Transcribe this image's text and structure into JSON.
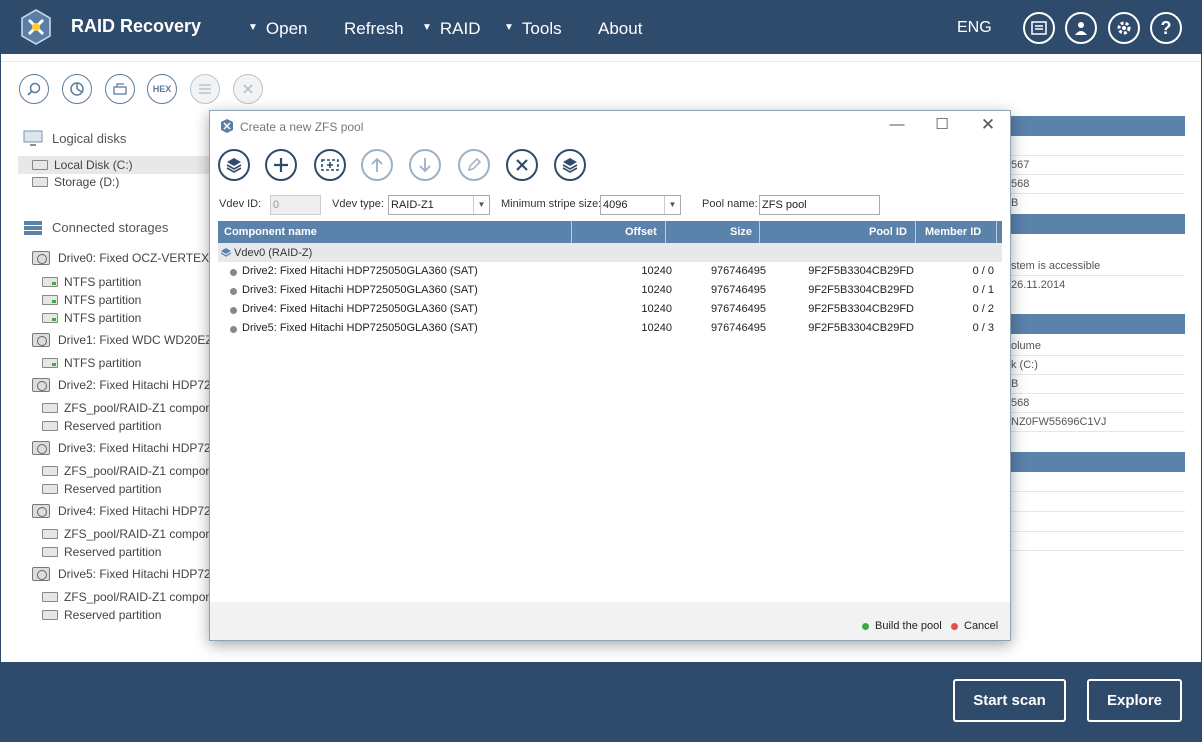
{
  "app": {
    "title": "RAID Recovery",
    "menu": [
      "Open",
      "Refresh",
      "RAID",
      "Tools",
      "About"
    ],
    "language": "ENG"
  },
  "header_icons": [
    "notes-icon",
    "user-icon",
    "gear-icon",
    "help-icon"
  ],
  "toolbar_icons": [
    "search-icon",
    "chart-icon",
    "partitions-icon",
    "hex-icon",
    "list-icon",
    "close-icon"
  ],
  "hex_label": "HEX",
  "left": {
    "logical_title": "Logical disks",
    "logical": [
      "Local Disk (C:)",
      "Storage (D:)"
    ],
    "connected_title": "Connected storages",
    "drives": [
      {
        "label": "Drive0: Fixed OCZ-VERTEX3",
        "children": [
          "NTFS partition",
          "NTFS partition",
          "NTFS partition"
        ],
        "green": true
      },
      {
        "label": "Drive1: Fixed WDC WD20EZ",
        "children": [
          "NTFS partition"
        ],
        "green": true
      },
      {
        "label": "Drive2: Fixed Hitachi HDP72",
        "children": [
          "ZFS_pool/RAID-Z1 compon",
          "Reserved partition"
        ],
        "green": false
      },
      {
        "label": "Drive3: Fixed Hitachi HDP72",
        "children": [
          "ZFS_pool/RAID-Z1 compon",
          "Reserved partition"
        ],
        "green": false
      },
      {
        "label": "Drive4: Fixed Hitachi HDP72",
        "children": [
          "ZFS_pool/RAID-Z1 compon",
          "Reserved partition"
        ],
        "green": false
      },
      {
        "label": "Drive5: Fixed Hitachi HDP72",
        "children": [
          "ZFS_pool/RAID-Z1 compon",
          "Reserved partition"
        ],
        "green": false
      }
    ]
  },
  "right_panel": {
    "rows": [
      "567",
      "568",
      "B",
      "stem is accessible",
      "26.11.2014",
      "olume",
      "k (C:)",
      "B",
      "568",
      "NZ0FW55696C1VJ"
    ]
  },
  "dialog": {
    "title": "Create a new ZFS pool",
    "vdev_id_label": "Vdev ID:",
    "vdev_id_value": "0",
    "vdev_type_label": "Vdev type:",
    "vdev_type_value": "RAID-Z1",
    "stripe_label": "Minimum stripe size:",
    "stripe_value": "4096",
    "pool_name_label": "Pool name:",
    "pool_name_value": "ZFS pool",
    "columns": {
      "name": "Component name",
      "offset": "Offset",
      "size": "Size",
      "pool_id": "Pool ID",
      "member_id": "Member ID"
    },
    "group": "Vdev0 (RAID-Z)",
    "rows": [
      {
        "name": "Drive2: Fixed Hitachi HDP725050GLA360 (SAT)",
        "offset": "10240",
        "size": "976746495",
        "pool_id": "9F2F5B3304CB29FD",
        "member_id": "0 / 0"
      },
      {
        "name": "Drive3: Fixed Hitachi HDP725050GLA360 (SAT)",
        "offset": "10240",
        "size": "976746495",
        "pool_id": "9F2F5B3304CB29FD",
        "member_id": "0 / 1"
      },
      {
        "name": "Drive4: Fixed Hitachi HDP725050GLA360 (SAT)",
        "offset": "10240",
        "size": "976746495",
        "pool_id": "9F2F5B3304CB29FD",
        "member_id": "0 / 2"
      },
      {
        "name": "Drive5: Fixed Hitachi HDP725050GLA360 (SAT)",
        "offset": "10240",
        "size": "976746495",
        "pool_id": "9F2F5B3304CB29FD",
        "member_id": "0 / 3"
      }
    ],
    "build_label": "Build the pool",
    "cancel_label": "Cancel",
    "build_color": "#3cab3c",
    "cancel_color": "#e05050"
  },
  "footer": {
    "start_scan": "Start scan",
    "explore": "Explore"
  }
}
